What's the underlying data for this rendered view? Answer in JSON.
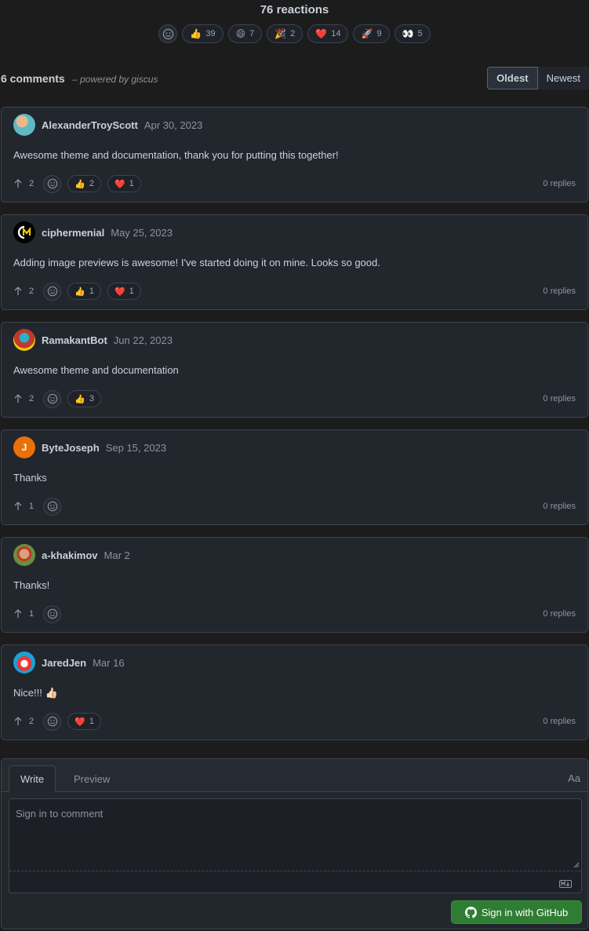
{
  "reactions": {
    "title": "76 reactions",
    "items": [
      {
        "emoji": "👍",
        "count": "39"
      },
      {
        "emoji": "😄",
        "count": "7"
      },
      {
        "emoji": "🎉",
        "count": "2"
      },
      {
        "emoji": "❤️",
        "count": "14"
      },
      {
        "emoji": "🚀",
        "count": "9"
      },
      {
        "emoji": "👀",
        "count": "5"
      }
    ]
  },
  "header": {
    "count": "6 comments",
    "powered": "– powered by giscus",
    "sort_oldest": "Oldest",
    "sort_newest": "Newest"
  },
  "comments": [
    {
      "author": "AlexanderTroyScott",
      "date": "Apr 30, 2023",
      "body": "Awesome theme and documentation, thank you for putting this together!",
      "upvotes": "2",
      "reactions": [
        {
          "emoji": "👍",
          "count": "2"
        },
        {
          "emoji": "❤️",
          "count": "1"
        }
      ],
      "replies": "0 replies"
    },
    {
      "author": "ciphermenial",
      "date": "May 25, 2023",
      "body": "Adding image previews is awesome! I've started doing it on mine. Looks so good.",
      "upvotes": "2",
      "reactions": [
        {
          "emoji": "👍",
          "count": "1"
        },
        {
          "emoji": "❤️",
          "count": "1"
        }
      ],
      "replies": "0 replies"
    },
    {
      "author": "RamakantBot",
      "date": "Jun 22, 2023",
      "body": "Awesome theme and documentation",
      "upvotes": "2",
      "reactions": [
        {
          "emoji": "👍",
          "count": "3"
        }
      ],
      "replies": "0 replies"
    },
    {
      "author": "ByteJoseph",
      "date": "Sep 15, 2023",
      "body": "Thanks",
      "upvotes": "1",
      "reactions": [],
      "replies": "0 replies",
      "avatar_letter": "J"
    },
    {
      "author": "a-khakimov",
      "date": "Mar 2",
      "body": "Thanks!",
      "upvotes": "1",
      "reactions": [],
      "replies": "0 replies"
    },
    {
      "author": "JaredJen",
      "date": "Mar 16",
      "body": "Nice!!! 👍🏻",
      "upvotes": "2",
      "reactions": [
        {
          "emoji": "❤️",
          "count": "1"
        }
      ],
      "replies": "0 replies"
    }
  ],
  "editor": {
    "tab_write": "Write",
    "tab_preview": "Preview",
    "aa": "Aa",
    "placeholder": "Sign in to comment",
    "signin_label": "Sign in with GitHub"
  },
  "colors": {
    "background": "#1c1c1d",
    "card": "#22272e",
    "border": "#3d444d",
    "signin": "#2e7d32"
  }
}
